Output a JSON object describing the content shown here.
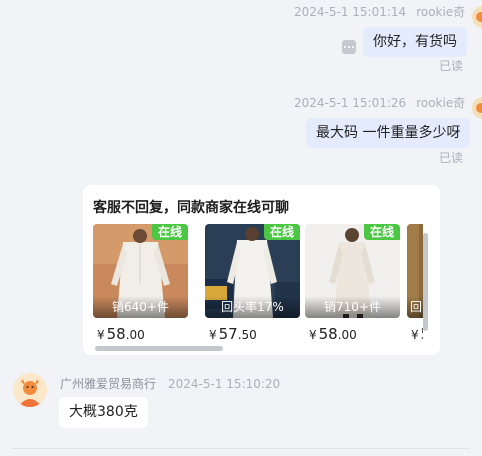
{
  "messages": [
    {
      "time": "2024-5-1 15:01:14",
      "sender": "rookie奇",
      "text": "你好，有货吗",
      "status": "已读"
    },
    {
      "time": "2024-5-1 15:01:26",
      "sender": "rookie奇",
      "text": "最大码 一件重量多少呀",
      "status": "已读"
    }
  ],
  "card": {
    "title": "客服不回复，同款商家在线可聊",
    "online_label": "在线",
    "currency": "¥",
    "products": [
      {
        "sold": "销640+件",
        "price_int": "58",
        "price_dec": ".00",
        "bg": "#c9895d"
      },
      {
        "sold": "回头率17%",
        "price_int": "57",
        "price_dec": ".50",
        "bg": "#1e3348"
      },
      {
        "sold": "销710+件",
        "price_int": "58",
        "price_dec": ".00",
        "bg": "#e6e4e2"
      },
      {
        "sold": "回",
        "price_int": "5",
        "price_dec": "",
        "bg": "#8b6a3e"
      }
    ]
  },
  "reply": {
    "sender": "广州雅爱贸易商行",
    "time": "2024-5-1 15:10:20",
    "text": "大概380克"
  },
  "icons": [
    "more-icon",
    "user-avatar",
    "shop-avatar"
  ]
}
